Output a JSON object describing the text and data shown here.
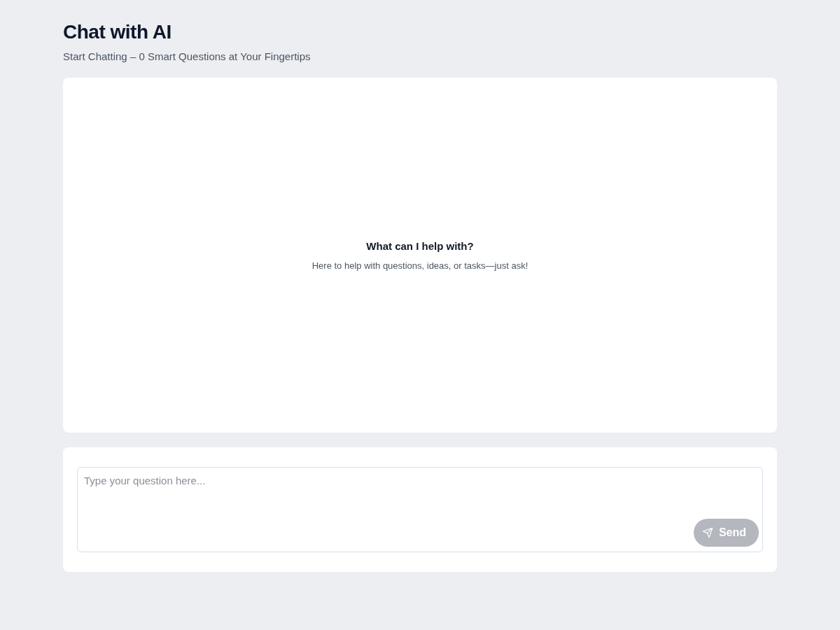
{
  "header": {
    "title": "Chat with AI",
    "subtitle": "Start Chatting – 0 Smart Questions at Your Fingertips"
  },
  "chat": {
    "empty_title": "What can I help with?",
    "empty_text": "Here to help with questions, ideas, or tasks—just ask!"
  },
  "composer": {
    "placeholder": "Type your question here...",
    "send_button": {
      "label": "Send",
      "disabled": true
    }
  }
}
